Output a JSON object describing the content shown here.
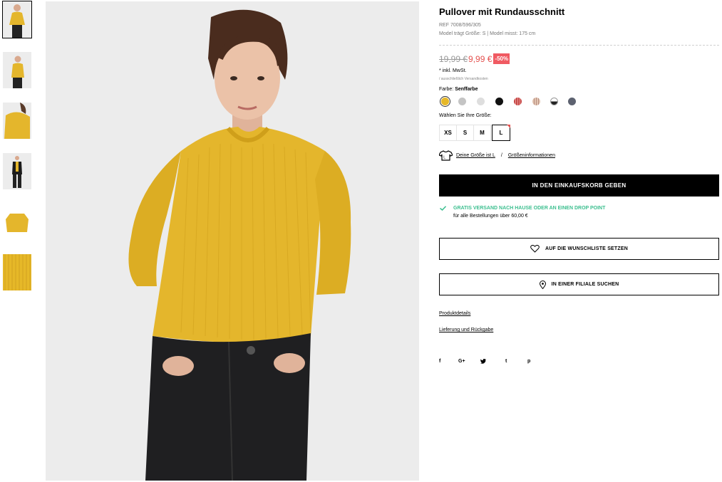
{
  "product": {
    "title": "Pullover mit Rundausschnitt",
    "ref": "REF 7008/596/305",
    "model_info": "Model trägt Größe: S | Model misst: 175 cm",
    "old_price": "19,99 €",
    "new_price": "9,99 €",
    "discount": "-50%",
    "vat": "* inkl. MwSt.",
    "shipping_note": "/ ausschließlich Versandkosten",
    "color_label": "Farbe:",
    "color_value": "Senffarbe",
    "size_label": "Wählen Sie Ihre Größe:"
  },
  "swatches": [
    {
      "name": "Senffarbe",
      "color": "#e6b828",
      "selected": true
    },
    {
      "name": "grey",
      "color": "#c4c4c4"
    },
    {
      "name": "light-grey",
      "color": "#dedede"
    },
    {
      "name": "black",
      "color": "#111111"
    },
    {
      "name": "red-stripe",
      "color": "#c64545"
    },
    {
      "name": "beige-stripe",
      "color": "#e2c5b2"
    },
    {
      "name": "black-white",
      "color": "#222222"
    },
    {
      "name": "slate",
      "color": "#5d6270"
    }
  ],
  "sizes": [
    "XS",
    "S",
    "M",
    "L"
  ],
  "selected_size": "L",
  "size_info": {
    "your_size": "Deine Größe ist L",
    "separator": "/",
    "info_link": "Größeninformationen"
  },
  "cart_button": "IN DEN EINKAUFSKORB GEBEN",
  "free_shipping": {
    "head": "GRATIS VERSAND NACH HAUSE ODER AN EINEN DROP POINT",
    "sub": "für alle Bestellungen über 60,00 €"
  },
  "wishlist_button": "AUF DIE WUNSCHLISTE SETZEN",
  "store_button": "IN EINER FILIALE SUCHEN",
  "links": {
    "details": "Produktdetails",
    "returns": "Lieferung und Rückgabe"
  },
  "social": [
    "f",
    "G+",
    "t-bird",
    "t",
    "p"
  ],
  "social_glyphs": [
    "f",
    "G+",
    "🐦",
    "t",
    "p"
  ],
  "colors": {
    "accent_red": "#e4514f",
    "discount_bg": "#f05a62",
    "success_green": "#3cbf8f",
    "sweater_yellow": "#e4b62c"
  }
}
